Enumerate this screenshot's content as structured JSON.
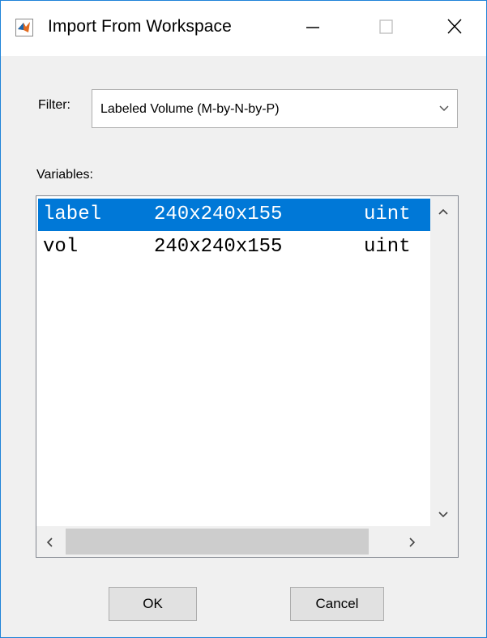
{
  "window": {
    "title": "Import From Workspace",
    "controls": {
      "minimize": "—",
      "maximize": "☐",
      "close": "✕"
    }
  },
  "filter": {
    "label": "Filter:",
    "selected": "Labeled Volume (M-by-N-by-P)"
  },
  "variables": {
    "label": "Variables:",
    "rows": [
      {
        "name": "label",
        "size": "240x240x155",
        "class": "uint",
        "selected": true
      },
      {
        "name": "vol",
        "size": "240x240x155",
        "class": "uint",
        "selected": false
      }
    ]
  },
  "buttons": {
    "ok": "OK",
    "cancel": "Cancel"
  },
  "colors": {
    "selection": "#0078d7",
    "window_border": "#1f83d8",
    "panel_bg": "#f0f0f0"
  },
  "icons": {
    "app": "matlab-logo-icon",
    "dropdown": "chevron-down-icon",
    "scroll_up": "chevron-up-icon",
    "scroll_down": "chevron-down-icon",
    "scroll_left": "chevron-left-icon",
    "scroll_right": "chevron-right-icon"
  }
}
